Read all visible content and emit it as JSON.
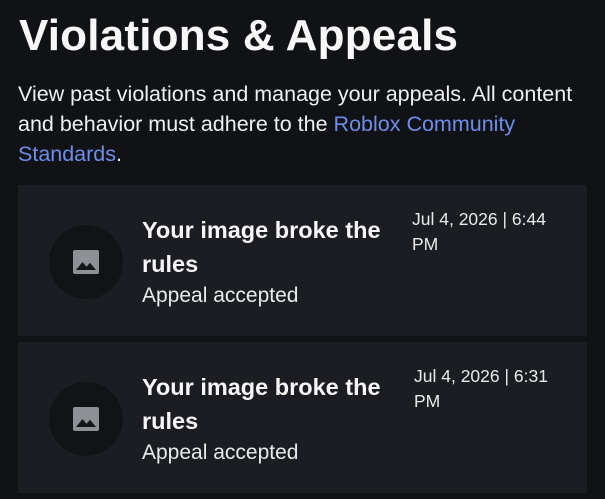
{
  "header": {
    "title": "Violations & Appeals"
  },
  "description": {
    "text_before_link": "View past violations and manage your appeals. All content and behavior must adhere to the ",
    "link_text": "Roblox Community Standards",
    "text_after_link": "."
  },
  "violations": [
    {
      "icon": "image-icon",
      "title": "Your image broke the rules",
      "status": "Appeal accepted",
      "date": "Jul 4, 2026 | 6:44 PM"
    },
    {
      "icon": "image-icon",
      "title": "Your image broke the rules",
      "status": "Appeal accepted",
      "date": "Jul 4, 2026 | 6:31 PM"
    }
  ],
  "colors": {
    "background": "#111216",
    "card": "#1c1d22",
    "link": "#6d8eea",
    "icon": "#8e9096"
  }
}
